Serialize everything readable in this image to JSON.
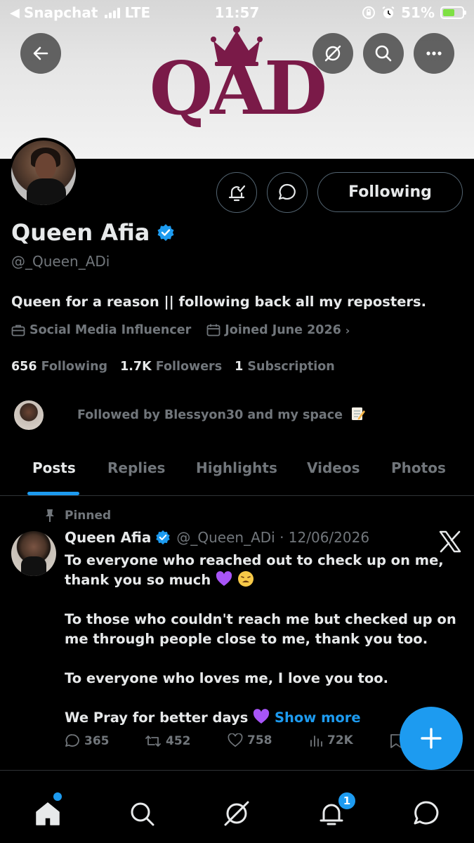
{
  "status_bar": {
    "app": "Snapchat",
    "network": "LTE",
    "time": "11:57",
    "battery": "51%"
  },
  "banner": {
    "logo_text": "QAD"
  },
  "profile": {
    "name": "Queen Afia",
    "handle": "@_Queen_ADi",
    "bio": "Queen for a reason || following back all my reposters.",
    "category": "Social Media Influencer",
    "joined": "Joined June 2026",
    "following_button": "Following",
    "stats": {
      "following_count": "656",
      "following_label": "Following",
      "followers_count": "1.7K",
      "followers_label": "Followers",
      "subscriptions_count": "1",
      "subscriptions_label": "Subscription"
    },
    "followed_by": "Followed by Blessyon30 and my space"
  },
  "tabs": [
    "Posts",
    "Replies",
    "Highlights",
    "Videos",
    "Photos"
  ],
  "post": {
    "pinned_label": "Pinned",
    "author": "Queen Afia",
    "handle_date": "@_Queen_ADi · 12/06/2026",
    "line1": "To everyone who reached out to check up on me, thank you so much",
    "line2": "To those who couldn't reach me but checked up on me through people close to me, thank you too.",
    "line3": "To everyone who loves me, I love you too.",
    "line4": "We Pray for better days",
    "show_more": "Show more",
    "replies": "365",
    "reposts": "452",
    "likes": "758",
    "views": "72K"
  },
  "nav": {
    "notifications_badge": "1"
  },
  "colors": {
    "accent": "#1d9bf0",
    "logo": "#7a1a48",
    "muted": "#71767b",
    "heart_emoji": "#a855f7"
  }
}
